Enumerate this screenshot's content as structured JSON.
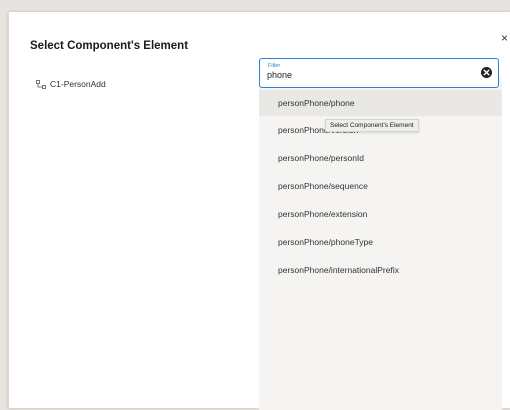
{
  "dialog": {
    "title": "Select Component's Element",
    "close_glyph": "×"
  },
  "tree": {
    "items": [
      {
        "label": "C1-PersonAdd",
        "icon": "tree-node-icon"
      }
    ]
  },
  "filter": {
    "label": "Filter",
    "value": "phone",
    "clear_icon": "clear-circle-icon"
  },
  "results": [
    {
      "label": "personPhone/phone"
    },
    {
      "label": "personPhone/version"
    },
    {
      "label": "personPhone/personId"
    },
    {
      "label": "personPhone/sequence"
    },
    {
      "label": "personPhone/extension"
    },
    {
      "label": "personPhone/phoneType"
    },
    {
      "label": "personPhone/internationalPrefix"
    }
  ],
  "tooltip": {
    "text": "Select Component's Element"
  },
  "colors": {
    "accent": "#2d7fd1",
    "panel_bg": "#f5f4f2",
    "hover_bg": "#e9e8e5"
  }
}
